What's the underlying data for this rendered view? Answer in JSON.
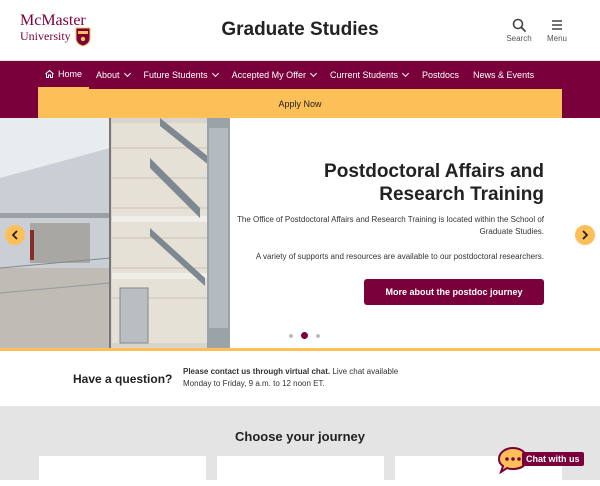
{
  "header": {
    "logo_line1": "McMaster",
    "logo_line2": "University",
    "site_title": "Graduate Studies",
    "search_label": "Search",
    "menu_label": "Menu"
  },
  "nav": {
    "items": [
      {
        "label": "Home",
        "icon": "home-icon",
        "active": true
      },
      {
        "label": "About",
        "dropdown": true
      },
      {
        "label": "Future Students",
        "dropdown": true
      },
      {
        "label": "Accepted My Offer",
        "dropdown": true
      },
      {
        "label": "Current Students",
        "dropdown": true
      },
      {
        "label": "Postdocs"
      },
      {
        "label": "News & Events"
      }
    ],
    "apply_label": "Apply Now"
  },
  "hero": {
    "title": "Postdoctoral Affairs and Research Training",
    "paragraph1": "The Office of Postdoctoral Affairs and Research Training is located within the School of Graduate Studies.",
    "paragraph2": "A variety of supports and resources are available to our postdoctoral researchers.",
    "cta_label": "More about the postdoc journey",
    "slide_count": 3,
    "active_slide": 2
  },
  "question": {
    "title": "Have a question?",
    "line1_bold": "Please contact us through virtual chat.",
    "line1_rest": " Live chat available",
    "line2": "Monday to Friday, 9 a.m. to 12 noon ET."
  },
  "journey": {
    "title": "Choose your journey"
  },
  "chat": {
    "label": "Chat with us"
  },
  "colors": {
    "maroon": "#7a003c",
    "gold": "#fdbf57",
    "grey_band": "#e4e4e4"
  }
}
